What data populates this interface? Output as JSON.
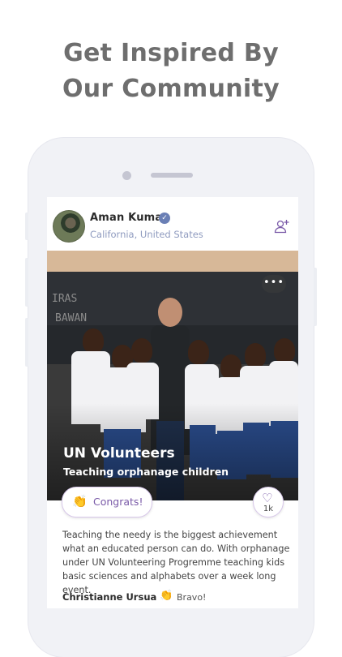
{
  "headline": {
    "line1": "Get Inspired By",
    "line2": "Our Community"
  },
  "post": {
    "user_name": "Aman Kumar",
    "verified_icon": "verified-check-icon",
    "location": "California, United States",
    "add_friend_icon": "add-user-icon",
    "more_label": "•••",
    "title": "UN Volunteers",
    "subtitle": "Teaching orphanage children",
    "congrats_label": "Congrats!",
    "congrats_icon": "clapping-hands-icon",
    "like_icon": "heart-icon",
    "like_count": "1k",
    "description": "Teaching the needy is the biggest achievement what an educated person can do. With orphanage under UN Volunteering Progremme teaching kids basic sciences and alphabets over a week long event.",
    "comment": {
      "author": "Christianne Ursua",
      "emoji_icon": "clapping-hands-icon",
      "text": "Bravo!"
    }
  },
  "colors": {
    "accent": "#7a5aa8",
    "location": "#8f9bbf",
    "verified": "#6a7fb5",
    "headline": "#6e6e6e"
  }
}
